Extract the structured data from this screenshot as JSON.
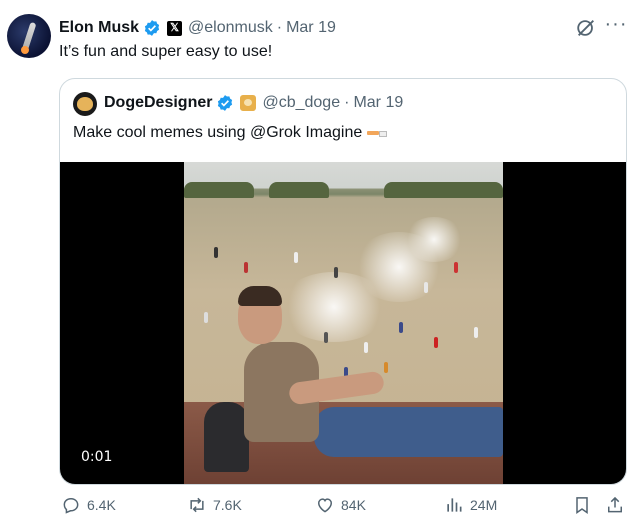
{
  "tweet": {
    "author_name": "Elon Musk",
    "author_handle": "@elonmusk",
    "separator": "·",
    "date": "Mar 19",
    "badge_letter": "𝕏",
    "text": "It’s fun and super easy to use!",
    "more_label": "···"
  },
  "quoted": {
    "author_name": "DogeDesigner",
    "author_handle": "@cb_doge",
    "separator": "·",
    "date": "Mar 19",
    "text": "Make cool memes using @Grok Imagine"
  },
  "video": {
    "timestamp": "0:01"
  },
  "actions": {
    "replies": "6.4K",
    "reposts": "7.6K",
    "likes": "84K",
    "views": "24M"
  },
  "colors": {
    "verified": "#1d9bf0",
    "muted": "#536471",
    "text": "#0f1419",
    "border": "#cfd9de"
  },
  "icons": [
    "verified-icon",
    "x-badge-icon",
    "grok-icon",
    "more-icon",
    "doge-badge-icon",
    "reply-icon",
    "repost-icon",
    "like-icon",
    "views-icon",
    "bookmark-icon",
    "share-icon"
  ]
}
